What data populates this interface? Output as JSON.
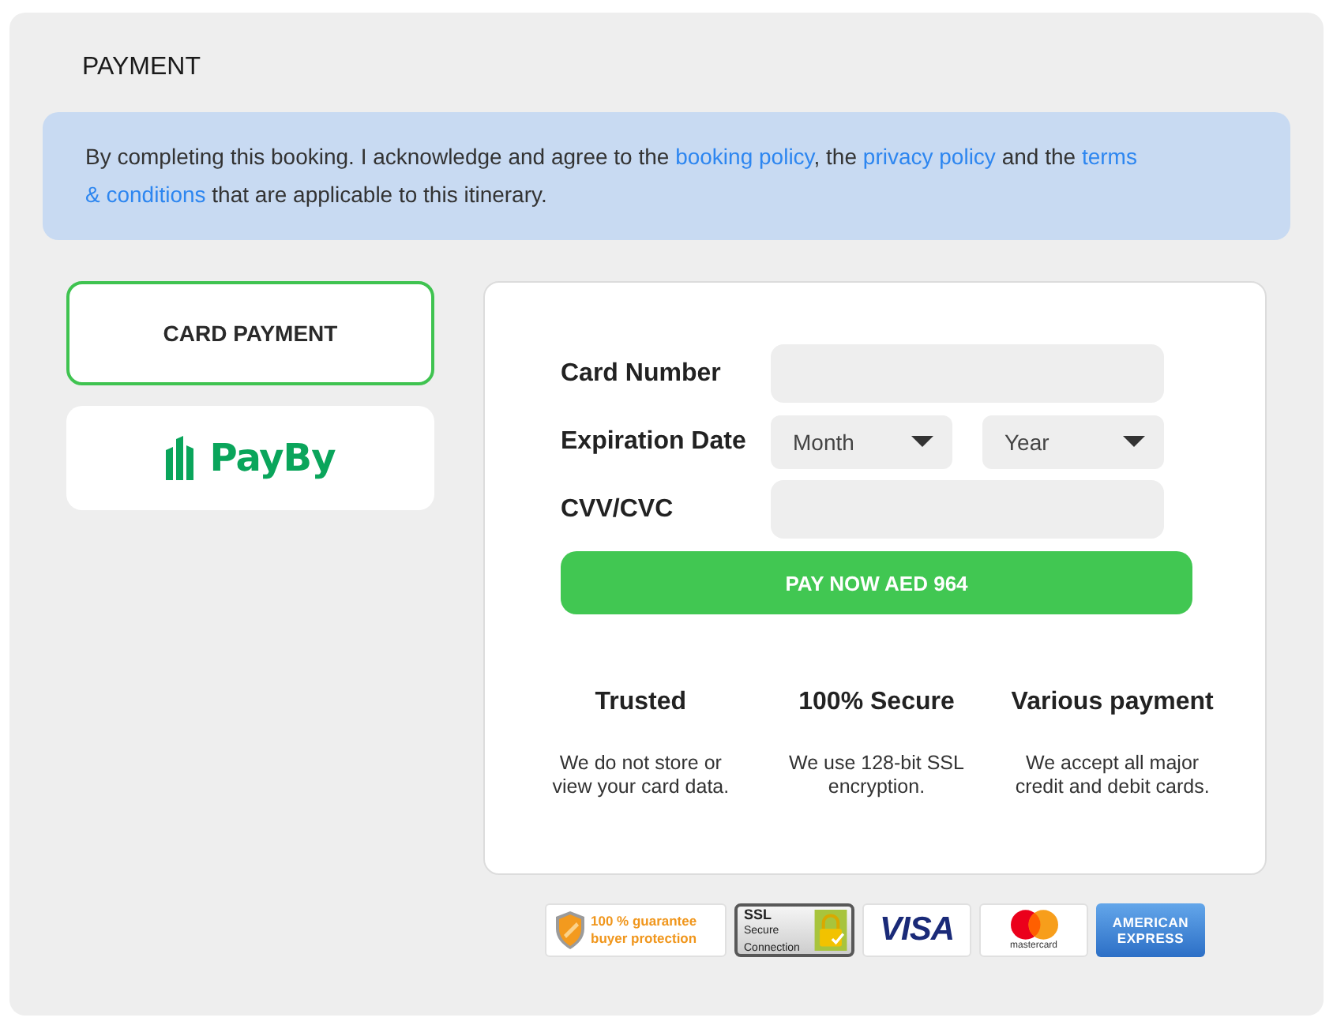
{
  "section": {
    "title": "PAYMENT"
  },
  "notice": {
    "lines": [
      [
        {
          "kind": "text",
          "text": "By completing this booking. I acknowledge and agree to the "
        },
        {
          "kind": "link",
          "text": "booking policy"
        },
        {
          "kind": "text",
          "text": ", the "
        },
        {
          "kind": "link",
          "text": "privacy policy"
        },
        {
          "kind": "text",
          "text": " and the "
        },
        {
          "kind": "link",
          "text": "terms"
        }
      ],
      [
        {
          "kind": "link",
          "text": "& conditions"
        },
        {
          "kind": "text",
          "text": " that are applicable to this itinerary."
        }
      ]
    ]
  },
  "payment_methods": [
    {
      "kind": "text",
      "label": "CARD PAYMENT",
      "selected": true
    },
    {
      "kind": "logo",
      "label": "PayBy",
      "selected": false
    }
  ],
  "card_form": {
    "fields": [
      {
        "kind": "input",
        "label": "Card Number"
      },
      {
        "kind": "date",
        "label": "Expiration Date",
        "selects": [
          {
            "placeholder": "Month"
          },
          {
            "placeholder": "Year"
          }
        ]
      },
      {
        "kind": "input",
        "label": "CVV/CVC"
      }
    ],
    "pay_button": "PAY NOW AED 964"
  },
  "features": [
    {
      "title": "Trusted",
      "lines": [
        "We do not store or",
        "view your card data."
      ]
    },
    {
      "title": "100% Secure",
      "lines": [
        "We use 128-bit SSL",
        "encryption."
      ]
    },
    {
      "title": "Various payment",
      "lines": [
        "We accept all major",
        "credit and debit cards."
      ]
    }
  ],
  "badges": [
    {
      "kind": "guarantee",
      "lines": [
        "100 % guarantee",
        "buyer protection"
      ]
    },
    {
      "kind": "ssl",
      "lines": [
        "SSL",
        "Secure",
        "Connection"
      ]
    },
    {
      "kind": "visa",
      "lines": [
        "VISA"
      ]
    },
    {
      "kind": "mastercard",
      "lines": [
        "mastercard"
      ]
    },
    {
      "kind": "amex",
      "lines": [
        "AMERICAN",
        "EXPRESS"
      ]
    }
  ]
}
